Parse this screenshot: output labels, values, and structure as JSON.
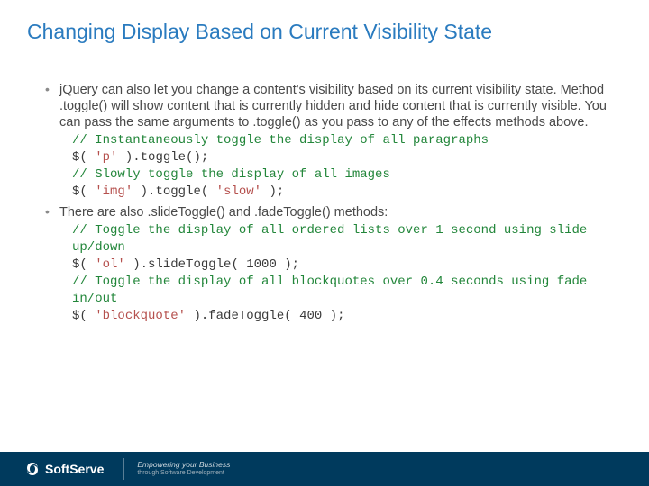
{
  "title": "Changing Display Based on Current Visibility State",
  "bullets": [
    {
      "text": "jQuery can also let you change a content's visibility based on its current visibility state. Method .toggle() will show content that is currently hidden and hide content that is currently visible. You can pass the same arguments to .toggle() as you pass to any of the effects methods above.",
      "code": [
        {
          "kind": "comment",
          "text": "// Instantaneously toggle the display of all paragraphs"
        },
        {
          "kind": "code",
          "parts": [
            {
              "t": "$( ",
              "cls": "plain"
            },
            {
              "t": "'p'",
              "cls": "string"
            },
            {
              "t": " ).toggle();",
              "cls": "plain"
            }
          ]
        },
        {
          "kind": "comment",
          "text": "// Slowly toggle the display of all images"
        },
        {
          "kind": "code",
          "parts": [
            {
              "t": "$( ",
              "cls": "plain"
            },
            {
              "t": "'img'",
              "cls": "string"
            },
            {
              "t": " ).toggle( ",
              "cls": "plain"
            },
            {
              "t": "'slow'",
              "cls": "string"
            },
            {
              "t": " );",
              "cls": "plain"
            }
          ]
        }
      ]
    },
    {
      "text": "There are also .slideToggle() and .fadeToggle() methods:",
      "code": [
        {
          "kind": "comment",
          "text": "// Toggle the display of all ordered lists over 1 second using slide up/down"
        },
        {
          "kind": "code",
          "parts": [
            {
              "t": "$( ",
              "cls": "plain"
            },
            {
              "t": "'ol'",
              "cls": "string"
            },
            {
              "t": " ).slideToggle( 1000 );",
              "cls": "plain"
            }
          ]
        },
        {
          "kind": "comment",
          "text": "// Toggle the display of all blockquotes over 0.4 seconds using fade in/out"
        },
        {
          "kind": "code",
          "parts": [
            {
              "t": "$( ",
              "cls": "plain"
            },
            {
              "t": "'blockquote'",
              "cls": "string"
            },
            {
              "t": " ).fadeToggle( 400 );",
              "cls": "plain"
            }
          ]
        }
      ]
    }
  ],
  "footer": {
    "brand": "SoftServe",
    "tagline1": "Empowering your Business",
    "tagline2": "through Software Development"
  }
}
